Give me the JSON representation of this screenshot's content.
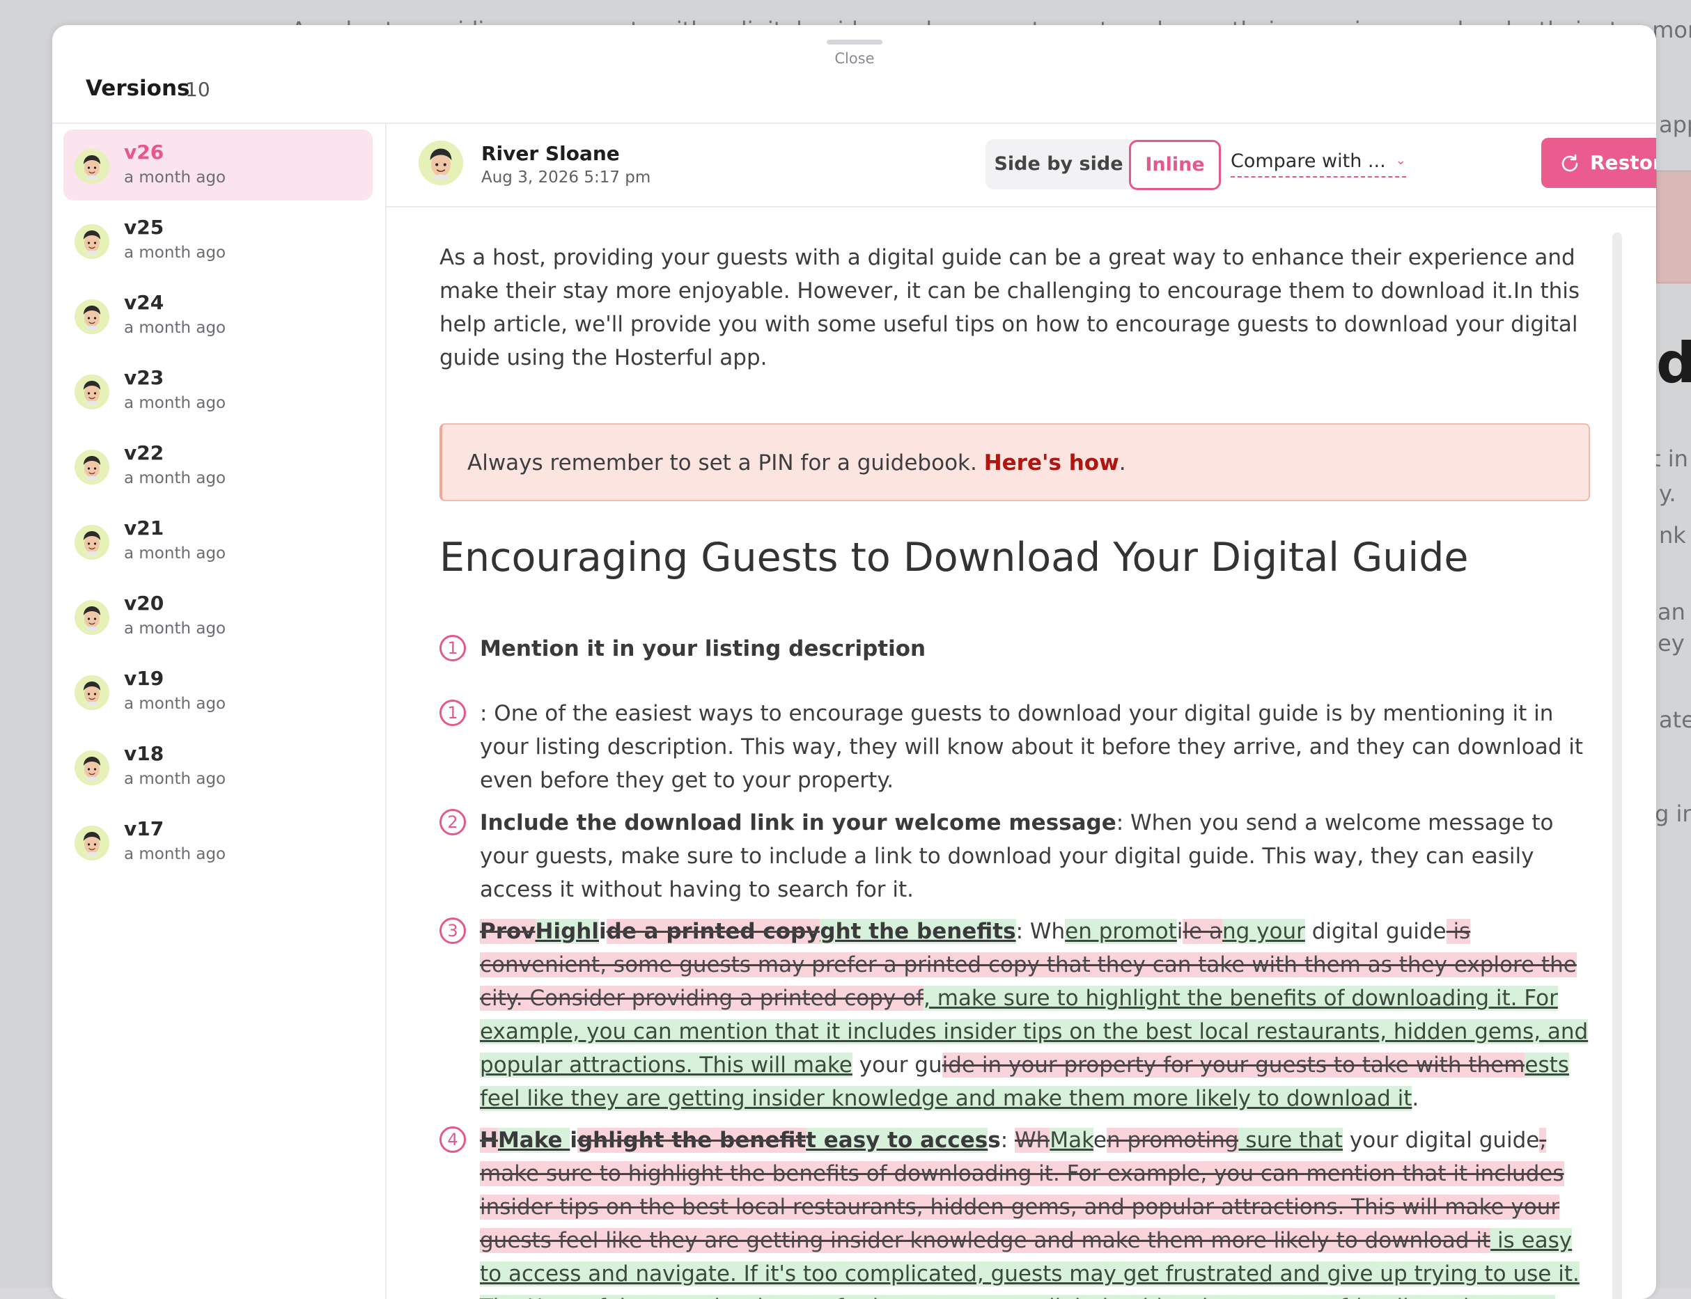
{
  "background": {
    "top_text": "As a host, providing your guests with a digital guide can be a great way to enhance their experience and make their stay more enjoyable. How",
    "right_fragments": [
      "app",
      "d",
      "t in y",
      "y.",
      "nk t",
      "an m",
      "ey a",
      "ate",
      "g in"
    ]
  },
  "modal": {
    "close_label": "Close",
    "title": "Versions",
    "count": "10"
  },
  "versions": [
    {
      "label": "v26",
      "time": "a month ago",
      "active": true
    },
    {
      "label": "v25",
      "time": "a month ago",
      "active": false
    },
    {
      "label": "v24",
      "time": "a month ago",
      "active": false
    },
    {
      "label": "v23",
      "time": "a month ago",
      "active": false
    },
    {
      "label": "v22",
      "time": "a month ago",
      "active": false
    },
    {
      "label": "v21",
      "time": "a month ago",
      "active": false
    },
    {
      "label": "v20",
      "time": "a month ago",
      "active": false
    },
    {
      "label": "v19",
      "time": "a month ago",
      "active": false
    },
    {
      "label": "v18",
      "time": "a month ago",
      "active": false
    },
    {
      "label": "v17",
      "time": "a month ago",
      "active": false
    }
  ],
  "header": {
    "author": "River Sloane",
    "date": "Aug 3, 2026 5:17 pm",
    "side_by_side": "Side by side",
    "inline": "Inline",
    "compare_with": "Compare with ...",
    "restore": "Restore"
  },
  "content": {
    "intro": "As a host, providing your guests with a digital guide can be a great way to enhance their experience and make their stay more enjoyable. However, it can be challenging to encourage them to download it.In this help article, we'll provide you with some useful tips on how to encourage guests to download your digital guide using the Hosterful app.",
    "callout_text": "Always remember to set a PIN for a guidebook. ",
    "callout_link": "Here's how",
    "callout_end": ".",
    "heading": "Encouraging Guests to Download Your Digital Guide",
    "items": [
      {
        "num": "1",
        "segments": [
          {
            "t": "b",
            "v": "Mention it in your listing description"
          }
        ]
      },
      {
        "num": "1",
        "segments": [
          {
            "t": "n",
            "v": ": One of the easiest ways to encourage guests to download your digital guide is by mentioning it in your listing description. This way, they will know about it before they arrive, and they can download it even before they get to your property."
          }
        ]
      },
      {
        "num": "2",
        "segments": [
          {
            "t": "b",
            "v": "Include the download link in your welcome message"
          },
          {
            "t": "n",
            "v": ": When you send a welcome message to your guests, make sure to include a link to download your digital guide. This way, they can easily access it without having to search for it."
          }
        ]
      },
      {
        "num": "3",
        "segments": [
          {
            "t": "bdel",
            "v": "Prov"
          },
          {
            "t": "bins",
            "v": "Highl"
          },
          {
            "t": "b",
            "v": "i"
          },
          {
            "t": "bdel",
            "v": "de a printed copy"
          },
          {
            "t": "bins",
            "v": "ght the benefits"
          },
          {
            "t": "n",
            "v": ": Wh"
          },
          {
            "t": "ins",
            "v": "en promot"
          },
          {
            "t": "n",
            "v": "i"
          },
          {
            "t": "del",
            "v": "le a"
          },
          {
            "t": "ins",
            "v": "ng your"
          },
          {
            "t": "n",
            "v": " digital guide"
          },
          {
            "t": "del",
            "v": " is convenient, some guests may prefer a printed copy that they can take with them as they explore the city. Consider providing a printed copy of"
          },
          {
            "t": "ins",
            "v": ", make sure to highlight the benefits of downloading it. For example, you can mention that it includes insider tips on the best local restaurants, hidden gems, and popular attractions. This will make"
          },
          {
            "t": "n",
            "v": " your gu"
          },
          {
            "t": "del",
            "v": "ide in your property for your guests to take with them"
          },
          {
            "t": "ins",
            "v": "ests feel like they are getting insider knowledge and make them more likely to download it"
          },
          {
            "t": "n",
            "v": "."
          }
        ]
      },
      {
        "num": "4",
        "segments": [
          {
            "t": "bdel",
            "v": "H"
          },
          {
            "t": "bins",
            "v": "Make "
          },
          {
            "t": "b",
            "v": "i"
          },
          {
            "t": "bdel",
            "v": "ghlight the benefit"
          },
          {
            "t": "bins",
            "v": "t easy to acces"
          },
          {
            "t": "b",
            "v": "s"
          },
          {
            "t": "n",
            "v": ": "
          },
          {
            "t": "del",
            "v": "Wh"
          },
          {
            "t": "ins",
            "v": "Mak"
          },
          {
            "t": "n",
            "v": "e"
          },
          {
            "t": "del",
            "v": "n promoting"
          },
          {
            "t": "ins",
            "v": " sure that"
          },
          {
            "t": "n",
            "v": " your digital guide"
          },
          {
            "t": "del",
            "v": ", make sure to highlight the benefits of downloading it. For example, you can mention that it includes insider tips on the best local restaurants, hidden gems, and popular attractions. This will make your guests feel like they are getting insider knowledge and make them more likely to download it"
          },
          {
            "t": "ins",
            "v": " is easy to access and navigate. If it's too complicated, guests may get frustrated and give up trying to use it. The Hosterful app makes it easy for hosts to create digital guides that are user-friendly and easy to navigate"
          },
          {
            "t": "n",
            "v": "."
          }
        ]
      }
    ]
  },
  "colors": {
    "accent": "#e6578d",
    "deleted_bg": "#f9d4da",
    "inserted_bg": "#d8f1da",
    "callout_bg": "#fce5e1",
    "callout_link": "#b0150f"
  },
  "icons": {
    "avatar": "avatar-icon",
    "restore": "restore-icon",
    "compare_chevron": "chevron-down-icon"
  }
}
